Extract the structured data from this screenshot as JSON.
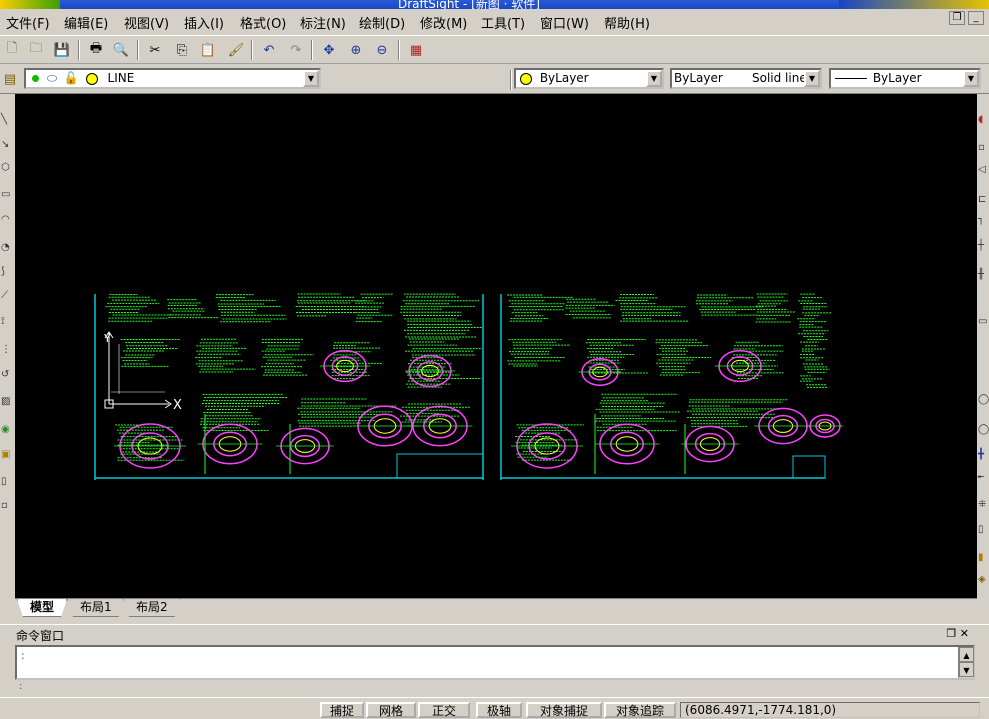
{
  "window": {
    "title": "DraftSight - [新图 · 软件]"
  },
  "menu": [
    "文件(F)",
    "编辑(E)",
    "视图(V)",
    "插入(I)",
    "格式(O)",
    "标注(N)",
    "绘制(D)",
    "修改(M)",
    "工具(T)",
    "窗口(W)",
    "帮助(H)"
  ],
  "properties": {
    "layer": "LINE",
    "color": "ByLayer",
    "linetype_left": "ByLayer",
    "linetype_right": "Solid line",
    "lineweight": "ByLayer"
  },
  "tabs": [
    "模型",
    "布局1",
    "布局2"
  ],
  "command": {
    "title": "命令窗口",
    "prompt1": ":",
    "prompt2": ":"
  },
  "status": {
    "snap": "捕捉",
    "grid": "网格",
    "ortho": "正交",
    "polar": "极轴",
    "osnap": "对象捕捉",
    "otrack": "对象追踪",
    "coords": "(6086.4971,-1774.181,0)"
  },
  "colors": {
    "canvas": "#000000",
    "drawing_green": "#22ff22",
    "drawing_magenta": "#ff40ff",
    "drawing_cyan": "#00c8d8",
    "drawing_yellow": "#ffff40"
  }
}
